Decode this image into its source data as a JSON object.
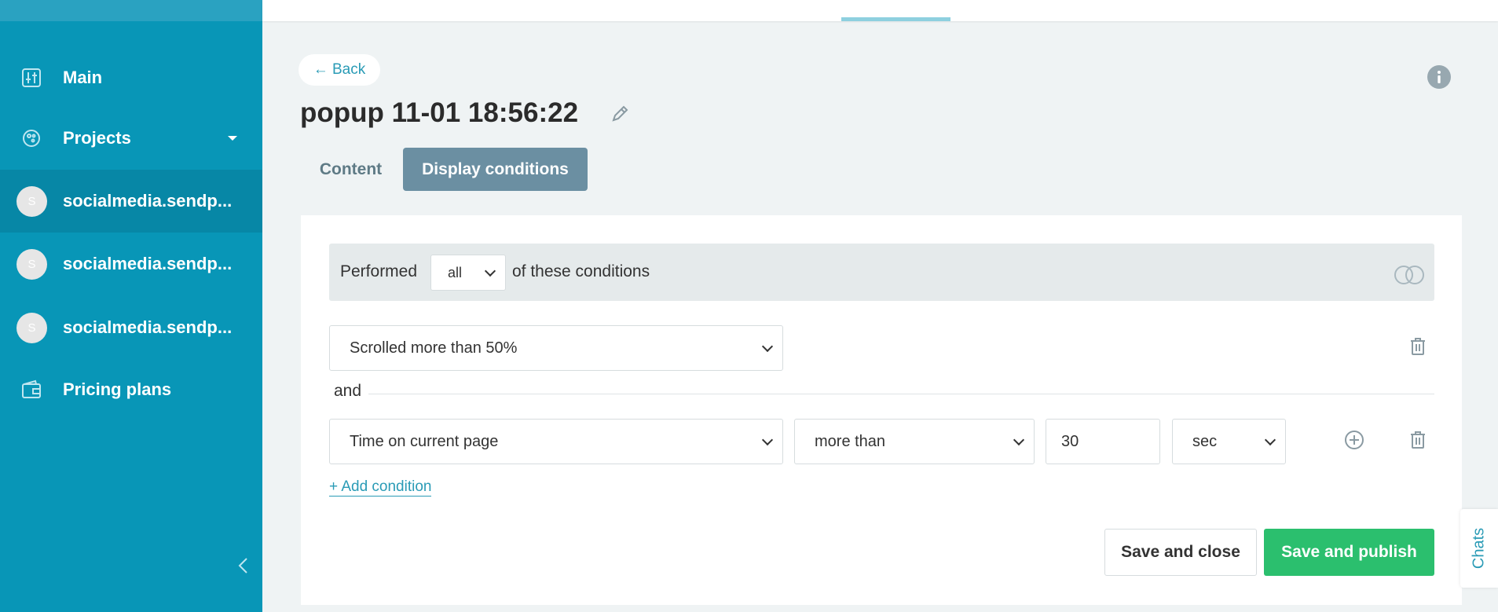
{
  "sidebar": {
    "items": [
      {
        "label": "Main",
        "icon": "sliders-icon"
      },
      {
        "label": "Projects",
        "icon": "palette-icon"
      },
      {
        "label": "socialmedia.sendp...",
        "avatar": "S"
      },
      {
        "label": "socialmedia.sendp...",
        "avatar": "S"
      },
      {
        "label": "socialmedia.sendp...",
        "avatar": "S"
      },
      {
        "label": "Pricing plans",
        "icon": "wallet-icon"
      }
    ]
  },
  "header": {
    "back_label": "← Back",
    "title": "popup 11-01 18:56:22"
  },
  "tabs": [
    {
      "label": "Content",
      "active": false
    },
    {
      "label": "Display conditions",
      "active": true
    }
  ],
  "conditions": {
    "header_prefix": "Performed",
    "match_mode": "all",
    "header_suffix": "of these conditions",
    "rule1": "Scrolled more than 50%",
    "joiner": "and",
    "rule2": {
      "type": "Time on current page",
      "operator": "more than",
      "value": "30",
      "unit": "sec"
    },
    "add_label": "+ Add condition"
  },
  "actions": {
    "save_close": "Save and close",
    "save_publish": "Save and publish"
  },
  "chats_label": "Chats",
  "colors": {
    "sidebar": "#0896b7",
    "accent": "#2a9bb6",
    "publish": "#2bbf6e",
    "tab_active": "#6b8fa2"
  }
}
